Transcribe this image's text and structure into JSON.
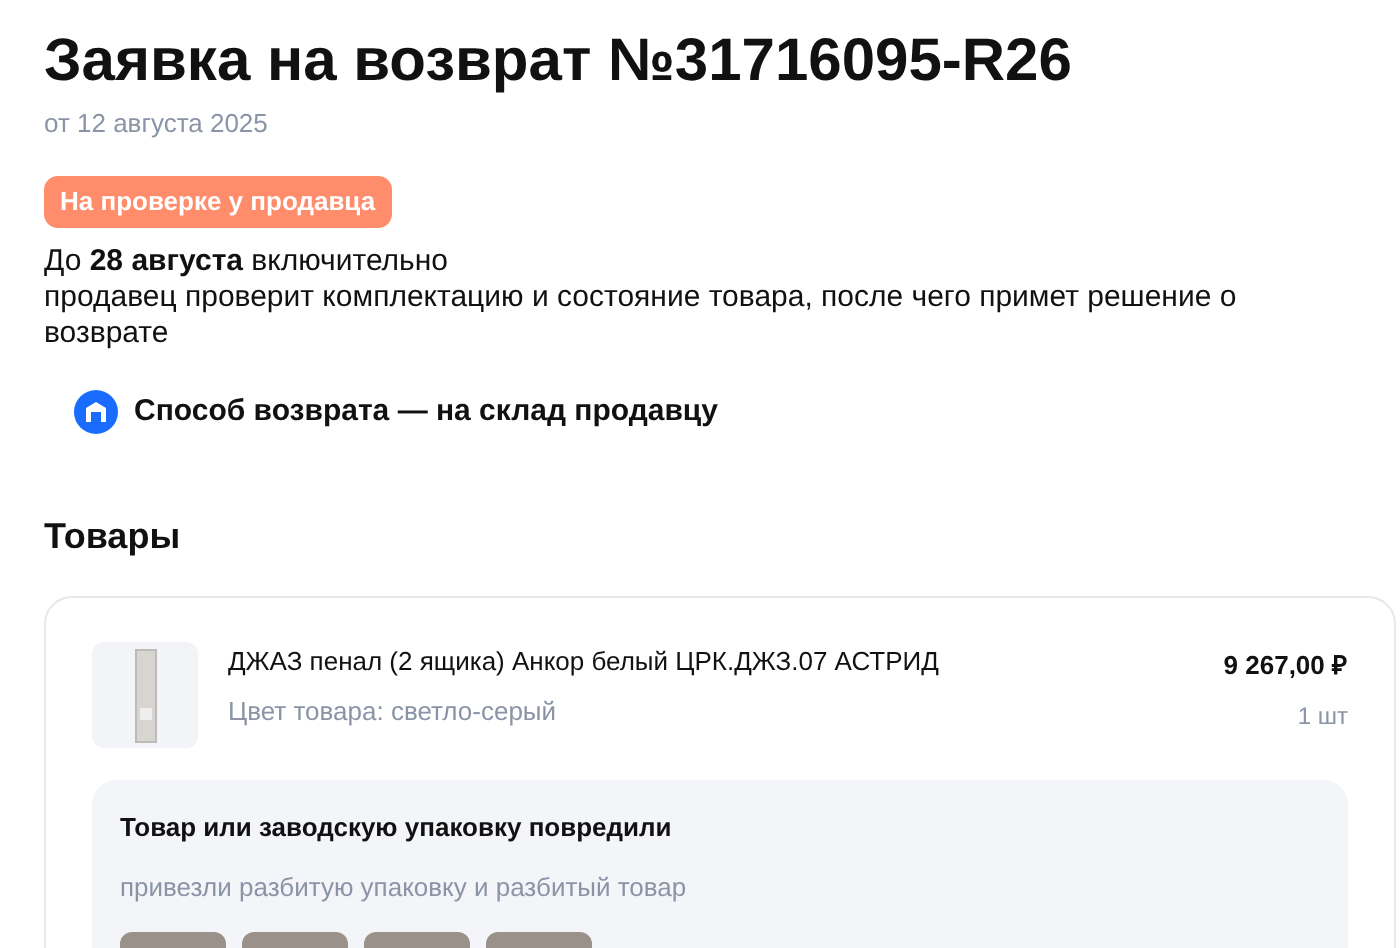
{
  "title": "Заявка на возврат №31716095-R26",
  "date": "от 12 августа 2025",
  "status": "На проверке у продавца",
  "description": "До **28 августа** включительно\nпродавец проверит комплектацию и состояние товара, после чего примет решение о возврате",
  "return_method": "Способ возврата — на склад продавцу",
  "goods_heading": "Товары",
  "items": [
    {
      "name": "ДЖАЗ пенал (2 ящика) Анкор белый ЦРК.ДЖЗ.07 АСТРИД",
      "color_label": "Цвет товара: светло-серый",
      "price": "9 267,00 ₽",
      "quantity": "1 шт",
      "reason": {
        "title": "Товар или заводскую упаковку повредили",
        "comment": "привезли разбитую упаковку и разбитый товар",
        "photos": [
          {
            "kind": "photo"
          },
          {
            "kind": "photo"
          },
          {
            "kind": "photo"
          },
          {
            "kind": "photo"
          }
        ]
      }
    }
  ]
}
